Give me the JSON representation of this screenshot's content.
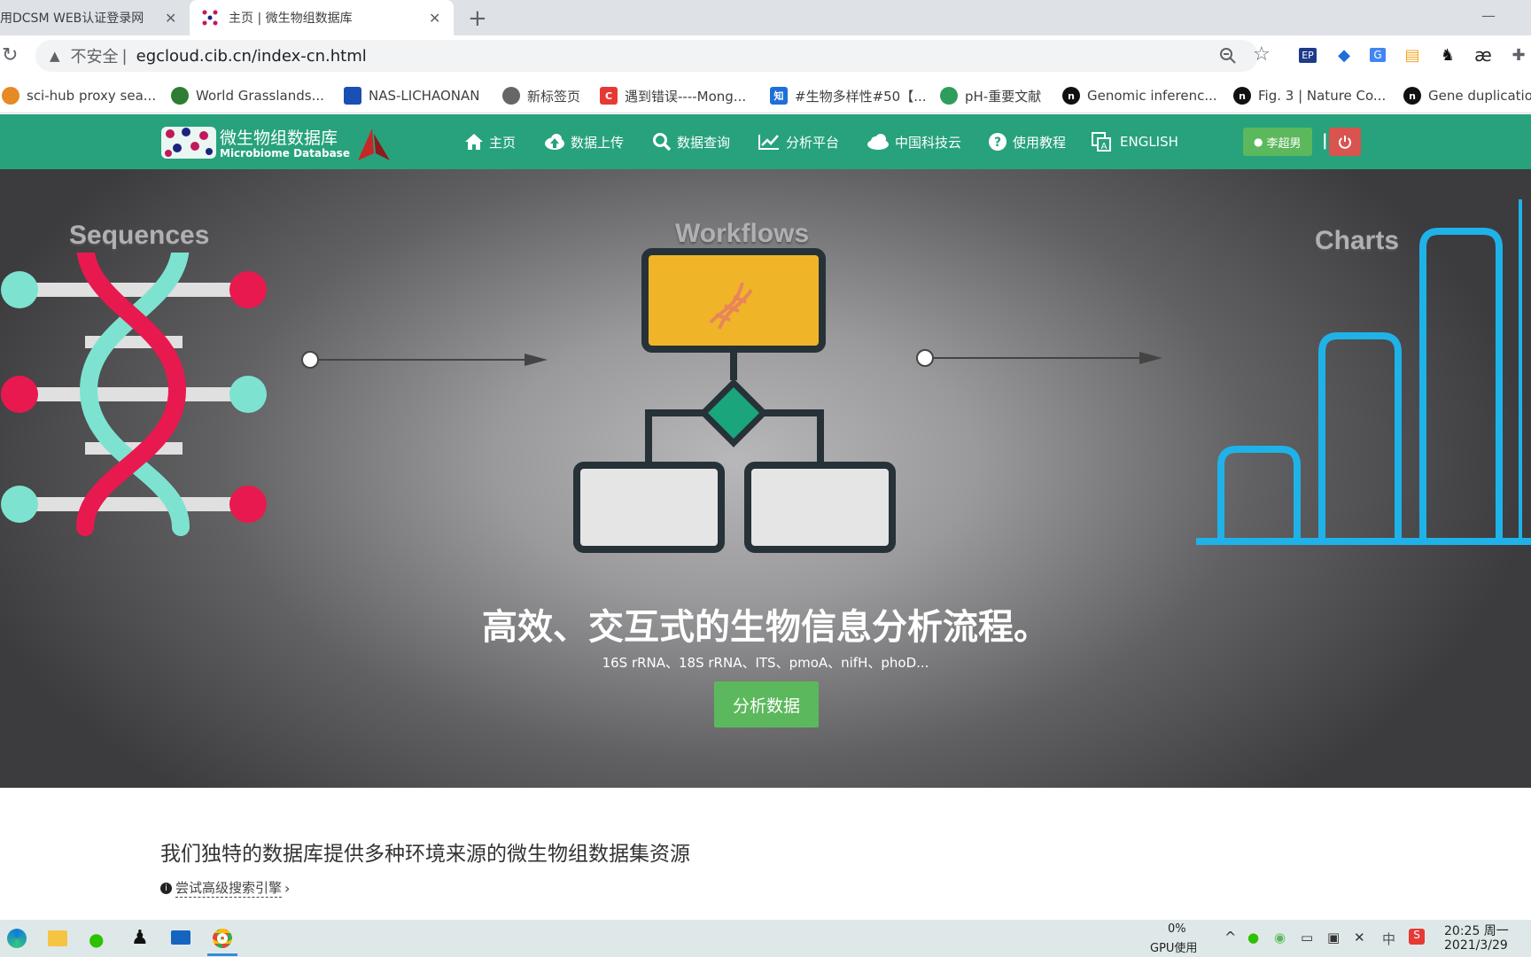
{
  "browser": {
    "tabs": [
      {
        "title": "使用DCSM WEB认证登录网"
      },
      {
        "title": "主页 | 微生物组数据库"
      }
    ],
    "address": {
      "security": "不安全",
      "separator": "|",
      "url": "egcloud.cib.cn/index-cn.html"
    },
    "bookmarks": [
      {
        "label": "sci-hub proxy sea...",
        "color": "#e58a24"
      },
      {
        "label": "World Grasslands...",
        "color": "#2e7d32"
      },
      {
        "label": "NAS-LICHAONAN",
        "color": "#1a4fb3"
      },
      {
        "label": "新标签页",
        "color": "#666666"
      },
      {
        "label": "遇到错误----Mong...",
        "color": "#e53935"
      },
      {
        "label": "#生物多样性#50【...",
        "color": "#1e6fd9"
      },
      {
        "label": "pH-重要文献",
        "color": "#2e9d5b"
      },
      {
        "label": "Genomic inferenc...",
        "color": "#111111"
      },
      {
        "label": "Fig. 3 | Nature Co...",
        "color": "#111111"
      },
      {
        "label": "Gene duplicatio",
        "color": "#111111"
      }
    ]
  },
  "site": {
    "logo": {
      "cn": "微生物组数据库",
      "en": "Microbiome Database"
    },
    "nav": [
      {
        "label": "主页",
        "icon": "home-icon"
      },
      {
        "label": "数据上传",
        "icon": "cloud-upload-icon"
      },
      {
        "label": "数据查询",
        "icon": "search-icon"
      },
      {
        "label": "分析平台",
        "icon": "line-chart-icon"
      },
      {
        "label": "中国科技云",
        "icon": "cloud-icon"
      },
      {
        "label": "使用教程",
        "icon": "question-circle-icon"
      },
      {
        "label": "ENGLISH",
        "icon": "language-icon"
      }
    ],
    "user": {
      "name": "李超男",
      "separator": "|"
    },
    "colors": {
      "nav": "#27a27c",
      "button": "#5cb85c",
      "logout": "#d9534f"
    }
  },
  "hero": {
    "labels": {
      "sequences": "Sequences",
      "workflows": "Workflows",
      "charts": "Charts"
    },
    "title": "高效、交互式的生物信息分析流程。",
    "subtitle": "16S rRNA、18S rRNA、ITS、pmoA、nifH、phoD...",
    "button": "分析数据"
  },
  "content": {
    "intro": "我们独特的数据库提供多种环境来源的微生物组数据集资源",
    "advanced_search": "尝试高级搜索引擎"
  },
  "taskbar": {
    "gpu_percent": "0%",
    "gpu_label": "GPU使用",
    "ime": "中",
    "time": "20:25 周一",
    "date": "2021/3/29"
  }
}
